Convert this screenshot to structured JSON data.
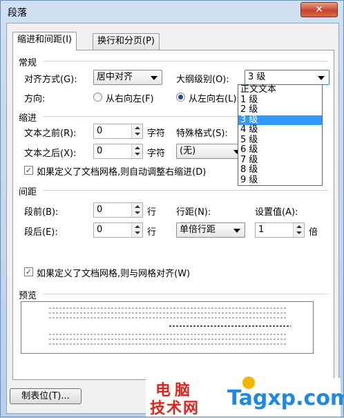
{
  "window": {
    "title": "段落",
    "close": "✕"
  },
  "tabs": [
    {
      "label": "缩进和间距(I)"
    },
    {
      "label": "换行和分页(P)"
    }
  ],
  "general": {
    "heading": "常规",
    "alignment_label": "对齐方式(G):",
    "alignment_value": "居中对齐",
    "outline_label": "大纲级别(O):",
    "outline_value": "3 级",
    "direction_label": "方向:",
    "rtl_label": "从右向左(F)",
    "ltr_label": "从左向右(L)"
  },
  "outline_options": [
    "正文文本",
    "1 级",
    "2 级",
    "3 级",
    "4 级",
    "5 级",
    "6 级",
    "7 级",
    "8 级",
    "9 级"
  ],
  "outline_selected_index": 3,
  "indent": {
    "heading": "缩进",
    "before_label": "文本之前(R):",
    "before_value": "0",
    "before_unit": "字符",
    "after_label": "文本之后(X):",
    "after_value": "0",
    "after_unit": "字符",
    "special_label": "特殊格式(S):",
    "special_value": "(无)",
    "auto_adjust_label": "如果定义了文档网格,则自动调整右缩进(D)",
    "auto_adjust_checked": true
  },
  "spacing": {
    "heading": "间距",
    "before_label": "段前(B):",
    "before_value": "0",
    "before_unit": "行",
    "after_label": "段后(E):",
    "after_value": "0",
    "after_unit": "行",
    "line_label": "行距(N):",
    "line_value": "单倍行距",
    "setting_label": "设置值(A):",
    "setting_value": "1",
    "setting_unit": "倍",
    "grid_label": "如果定义了文档网格,则与网格对齐(W)",
    "grid_checked": true
  },
  "preview": {
    "heading": "预览"
  },
  "buttons": {
    "tabs": "制表位(T)..."
  },
  "watermark": {
    "cn_top": "电脑",
    "cn_bottom": "技术网",
    "en": "Tagxp.com"
  }
}
